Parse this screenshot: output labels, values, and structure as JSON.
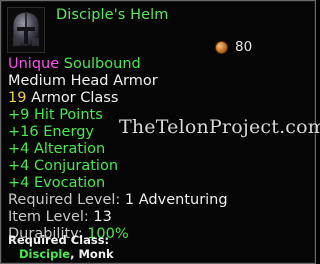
{
  "item": {
    "name": "Disciple's Helm",
    "value": "80",
    "icon": "helm-icon",
    "rarity": "Unique",
    "binding": "Soulbound",
    "type": "Medium Head Armor",
    "armor_class_value": "19",
    "armor_class_label": "Armor Class",
    "stats": [
      "+9 Hit Points",
      "+16 Energy",
      "+4 Alteration",
      "+4 Conjuration",
      "+4 Evocation"
    ],
    "required_level_label": "Required Level:",
    "required_level_value": "1 Adventuring",
    "item_level_label": "Item Level:",
    "item_level_value": "13",
    "durability_label": "Durability:",
    "durability_value": "100%",
    "required_class_label": "Required Class:",
    "required_class_1": "Disciple",
    "required_class_sep": ",",
    "required_class_2": "Monk"
  },
  "watermark": "TheTelonProject.com",
  "colors": {
    "unique": "#ff4df0",
    "green": "#49e84c",
    "yellow": "#f0d24a",
    "text": "#f0f0f0"
  }
}
